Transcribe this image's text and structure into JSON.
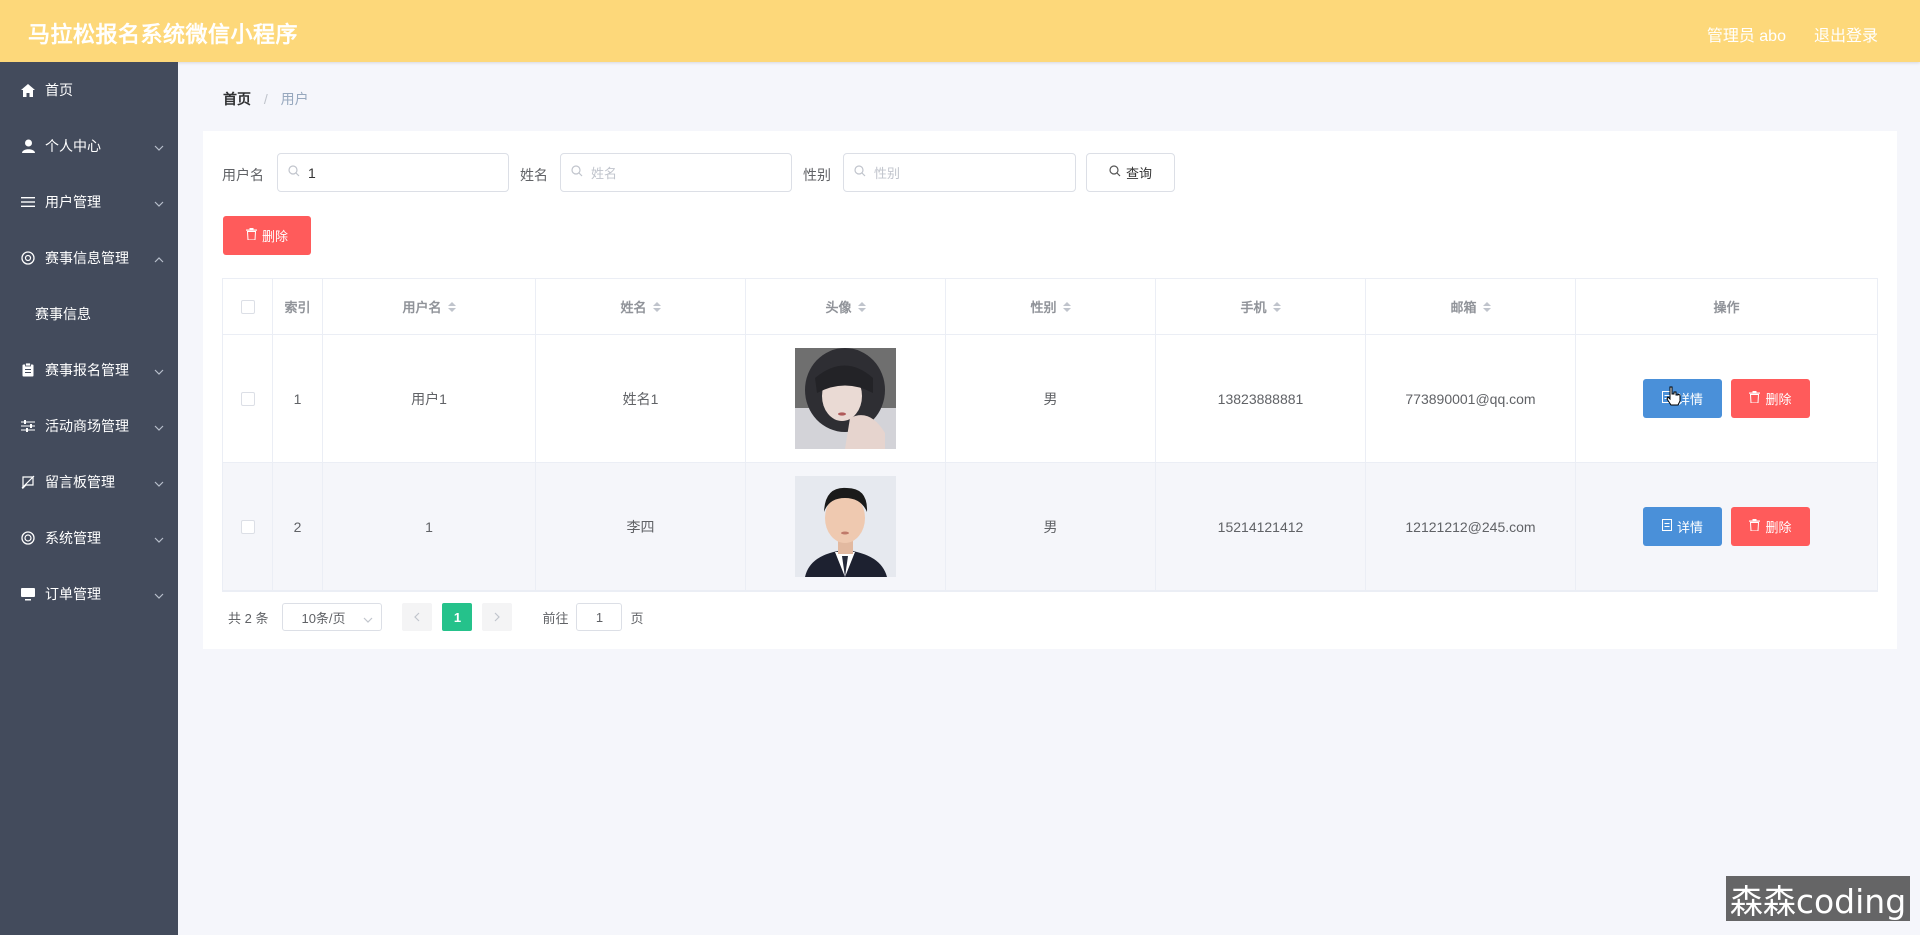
{
  "header": {
    "title": "马拉松报名系统微信小程序",
    "user": "管理员 abo",
    "logout": "退出登录"
  },
  "sidebar": {
    "items": [
      {
        "label": "首页",
        "icon": "home-icon"
      },
      {
        "label": "个人中心",
        "icon": "user-icon"
      },
      {
        "label": "用户管理",
        "icon": "list-icon"
      },
      {
        "label": "赛事信息管理",
        "icon": "help-circle-icon",
        "expanded": true
      },
      {
        "label": "赛事信息",
        "sub": true
      },
      {
        "label": "赛事报名管理",
        "icon": "clipboard-icon"
      },
      {
        "label": "活动商场管理",
        "icon": "sliders-icon"
      },
      {
        "label": "留言板管理",
        "icon": "message-off-icon"
      },
      {
        "label": "系统管理",
        "icon": "settings-icon"
      },
      {
        "label": "订单管理",
        "icon": "monitor-icon"
      }
    ]
  },
  "breadcrumb": {
    "home": "首页",
    "separator": "/",
    "current": "用户"
  },
  "search": {
    "username_label": "用户名",
    "username_value": "1",
    "name_label": "姓名",
    "name_placeholder": "姓名",
    "gender_label": "性别",
    "gender_placeholder": "性别",
    "query_button": "查询"
  },
  "batch_delete_button": "删除",
  "table": {
    "columns": [
      "索引",
      "用户名",
      "姓名",
      "头像",
      "性别",
      "手机",
      "邮箱",
      "操作"
    ],
    "rows": [
      {
        "index": "1",
        "username": "用户1",
        "name": "姓名1",
        "gender": "男",
        "phone": "13823888881",
        "email": "773890001@qq.com",
        "avatar": "female-avatar"
      },
      {
        "index": "2",
        "username": "1",
        "name": "李四",
        "gender": "男",
        "phone": "15214121412",
        "email": "12121212@245.com",
        "avatar": "male-avatar"
      }
    ],
    "detail_button": "详情",
    "delete_button": "删除"
  },
  "pagination": {
    "total_text": "共 2 条",
    "page_size": "10条/页",
    "current_page": "1",
    "goto_label": "前往",
    "goto_value": "1",
    "page_suffix": "页"
  },
  "watermark": "森森coding",
  "colors": {
    "header": "#fdd87a",
    "sidebar": "#434b5c",
    "danger": "#ff5b5b",
    "primary": "#4a90d9",
    "active_page": "#25c28b"
  }
}
